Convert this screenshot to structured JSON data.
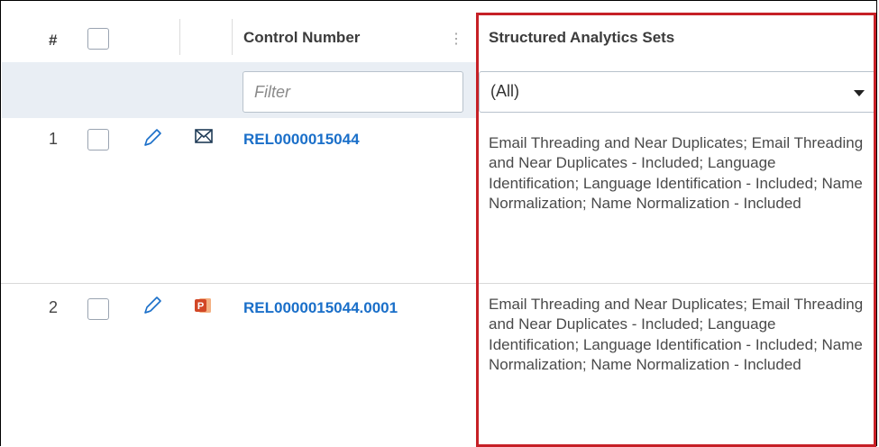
{
  "header": {
    "row_number_label": "#",
    "control_number_label": "Control Number",
    "column_menu_glyph": "⋮",
    "analytics_label": "Structured Analytics Sets"
  },
  "filters": {
    "control_number_placeholder": "Filter",
    "analytics_selected": "(All)"
  },
  "rows": [
    {
      "number": "1",
      "file_icon": "email-icon",
      "control_number": "REL0000015044",
      "analytics_text": "Email Threading and Near Duplicates; Email Threading and Near Duplicates - Included; Language Identification; Language Identification - Included; Name Normalization; Name Normalization - Included"
    },
    {
      "number": "2",
      "file_icon": "powerpoint-icon",
      "control_number": "REL0000015044.0001",
      "analytics_text": "Email Threading and Near Duplicates; Email Threading and Near Duplicates - Included; Language Identification; Language Identification - Included; Name Normalization; Name Normalization - Included"
    }
  ],
  "colors": {
    "link": "#1a6fc9",
    "highlight_border": "#c62026",
    "filter_band": "#e9eef4",
    "powerpoint": "#d24726"
  }
}
